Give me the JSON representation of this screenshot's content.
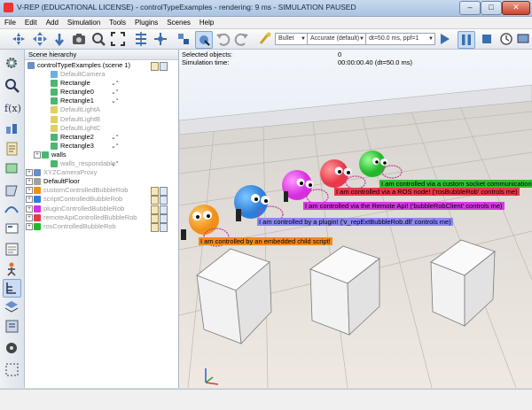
{
  "window": {
    "title": "V-REP (EDUCATIONAL LICENSE) - controlTypeExamples - rendering: 9 ms - SIMULATION PAUSED",
    "buttons": {
      "minimize": "–",
      "maximize": "□",
      "close": "✕"
    }
  },
  "menu": [
    "File",
    "Edit",
    "Add",
    "Simulation",
    "Tools",
    "Plugins",
    "Scenes",
    "Help"
  ],
  "toolbar": {
    "engine": "Bullet",
    "accuracy": "Accurate (default)",
    "timestep": "dt=50.0 ms, ppf=1"
  },
  "hierarchy": {
    "header": "Scene hierarchy",
    "scene_name": "controlTypeExamples (scene 1)",
    "items": [
      {
        "label": "DefaultCamera",
        "dim": true
      },
      {
        "label": "Rectangle",
        "dim": false
      },
      {
        "label": "Rectangle0",
        "dim": false
      },
      {
        "label": "Rectangle1",
        "dim": false
      },
      {
        "label": "DefaultLightA",
        "dim": true
      },
      {
        "label": "DefaultLightB",
        "dim": true
      },
      {
        "label": "DefaultLightC",
        "dim": true
      },
      {
        "label": "Rectangle2",
        "dim": false
      },
      {
        "label": "Rectangle3",
        "dim": false
      },
      {
        "label": "walls",
        "dim": false
      },
      {
        "label": "walls_respondable",
        "dim": true
      },
      {
        "label": "XYZCameraProxy",
        "dim": true
      },
      {
        "label": "DefaultFloor",
        "dim": false
      },
      {
        "label": "customControlledBubbleRob",
        "dim": true
      },
      {
        "label": "scriptControlledBubbleRob",
        "dim": true
      },
      {
        "label": "pluginControlledBubbleRob",
        "dim": true
      },
      {
        "label": "remoteApiControlledBubbleRob",
        "dim": true
      },
      {
        "label": "rosControlledBubbleRob",
        "dim": true
      }
    ]
  },
  "viewport": {
    "info": {
      "selected_label": "Selected objects:",
      "selected_value": "0",
      "time_label": "Simulation time:",
      "time_value": "00:00:00.40 (dt=50.0 ms)"
    },
    "labels": {
      "socket": "I am controlled via a custom socket communication!",
      "ros": "I am controlled via a ROS node! ('rosBubbleRob' controls me)",
      "remote": "I am controlled via the Remote Api! ('bubbleRobClient' controls me)",
      "plugin": "I am controlled by a plugin! ('v_repExtBubbleRob.dll' controls me)",
      "child": "I am controlled by an embedded child script!"
    },
    "colors": {
      "socket": "#2fbf2f",
      "ros": "#e8384a",
      "remote": "#d23be0",
      "plugin": "#8a86f2",
      "child": "#f08a20"
    }
  }
}
